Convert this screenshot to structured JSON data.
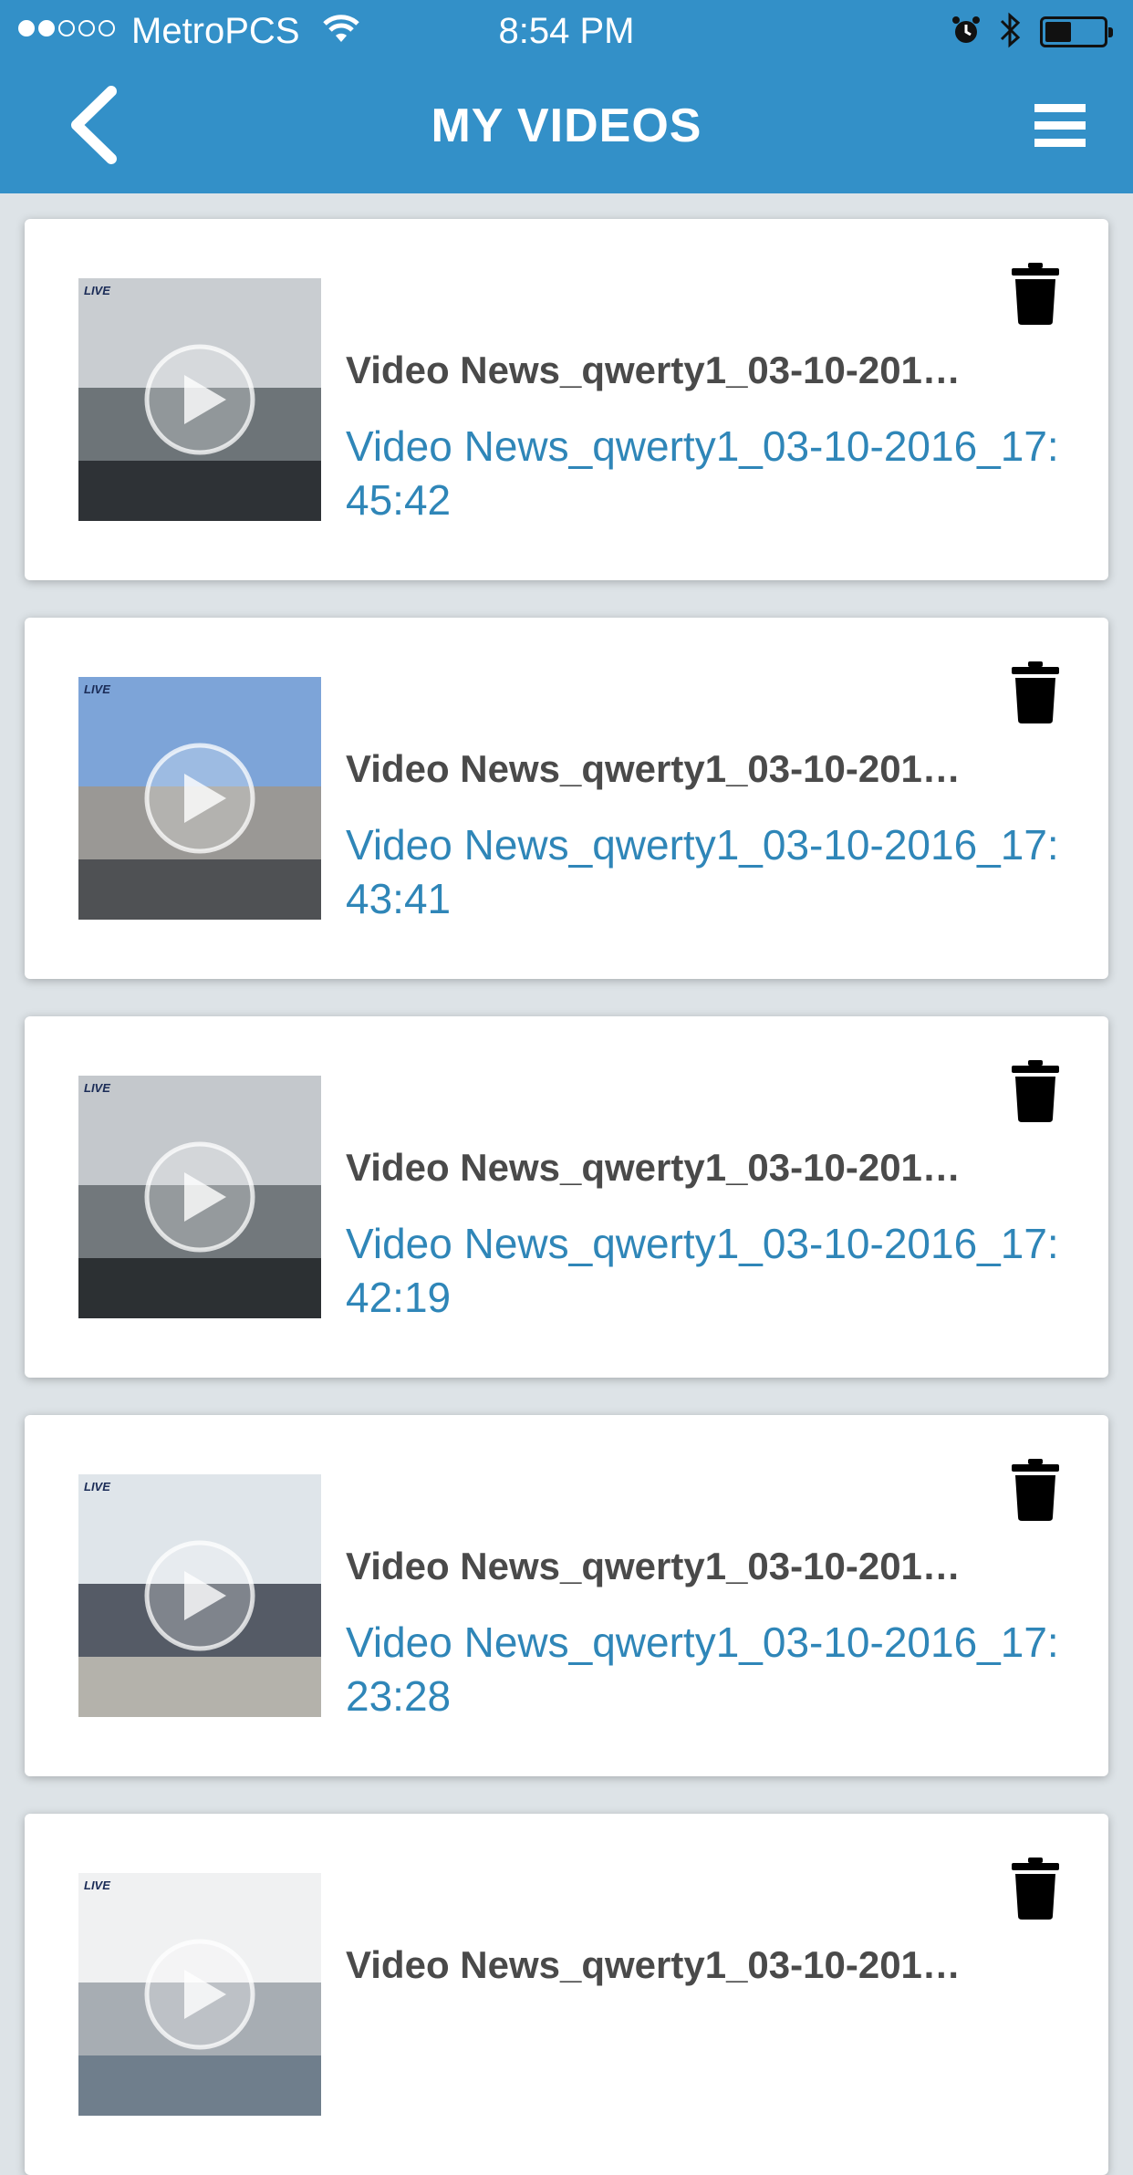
{
  "status": {
    "carrier": "MetroPCS",
    "time": "8:54 PM",
    "battery_level": 0.45
  },
  "header": {
    "title": "MY VIDEOS"
  },
  "videos": [
    {
      "title": "Video News_qwerty1_03-10-201…",
      "subtitle": "Video News_qwerty1_03-10-2016_17:45:42",
      "thumb_palette": [
        "#c9cdd1",
        "#6d7478",
        "#2e3236"
      ]
    },
    {
      "title": "Video News_qwerty1_03-10-201…",
      "subtitle": "Video News_qwerty1_03-10-2016_17:43:41",
      "thumb_palette": [
        "#7da4d8",
        "#9a9895",
        "#4f5154"
      ]
    },
    {
      "title": "Video News_qwerty1_03-10-201…",
      "subtitle": "Video News_qwerty1_03-10-2016_17:42:19",
      "thumb_palette": [
        "#c4c8cc",
        "#72787c",
        "#2c3033"
      ]
    },
    {
      "title": "Video News_qwerty1_03-10-201…",
      "subtitle": "Video News_qwerty1_03-10-2016_17:23:28",
      "thumb_palette": [
        "#dfe5ea",
        "#555b66",
        "#b4b2ab"
      ]
    },
    {
      "title": "Video News_qwerty1_03-10-201…",
      "subtitle": "",
      "thumb_palette": [
        "#f0f1f2",
        "#a7adb3",
        "#6f7e8c"
      ]
    }
  ],
  "colors": {
    "brand": "#3390c8",
    "subtitle": "#2f86b8",
    "title": "#4a4a4a",
    "background": "#dde3e7"
  },
  "icons": {
    "back": "chevron-left-icon",
    "menu": "hamburger-menu-icon",
    "delete": "trash-icon",
    "play": "play-icon"
  }
}
